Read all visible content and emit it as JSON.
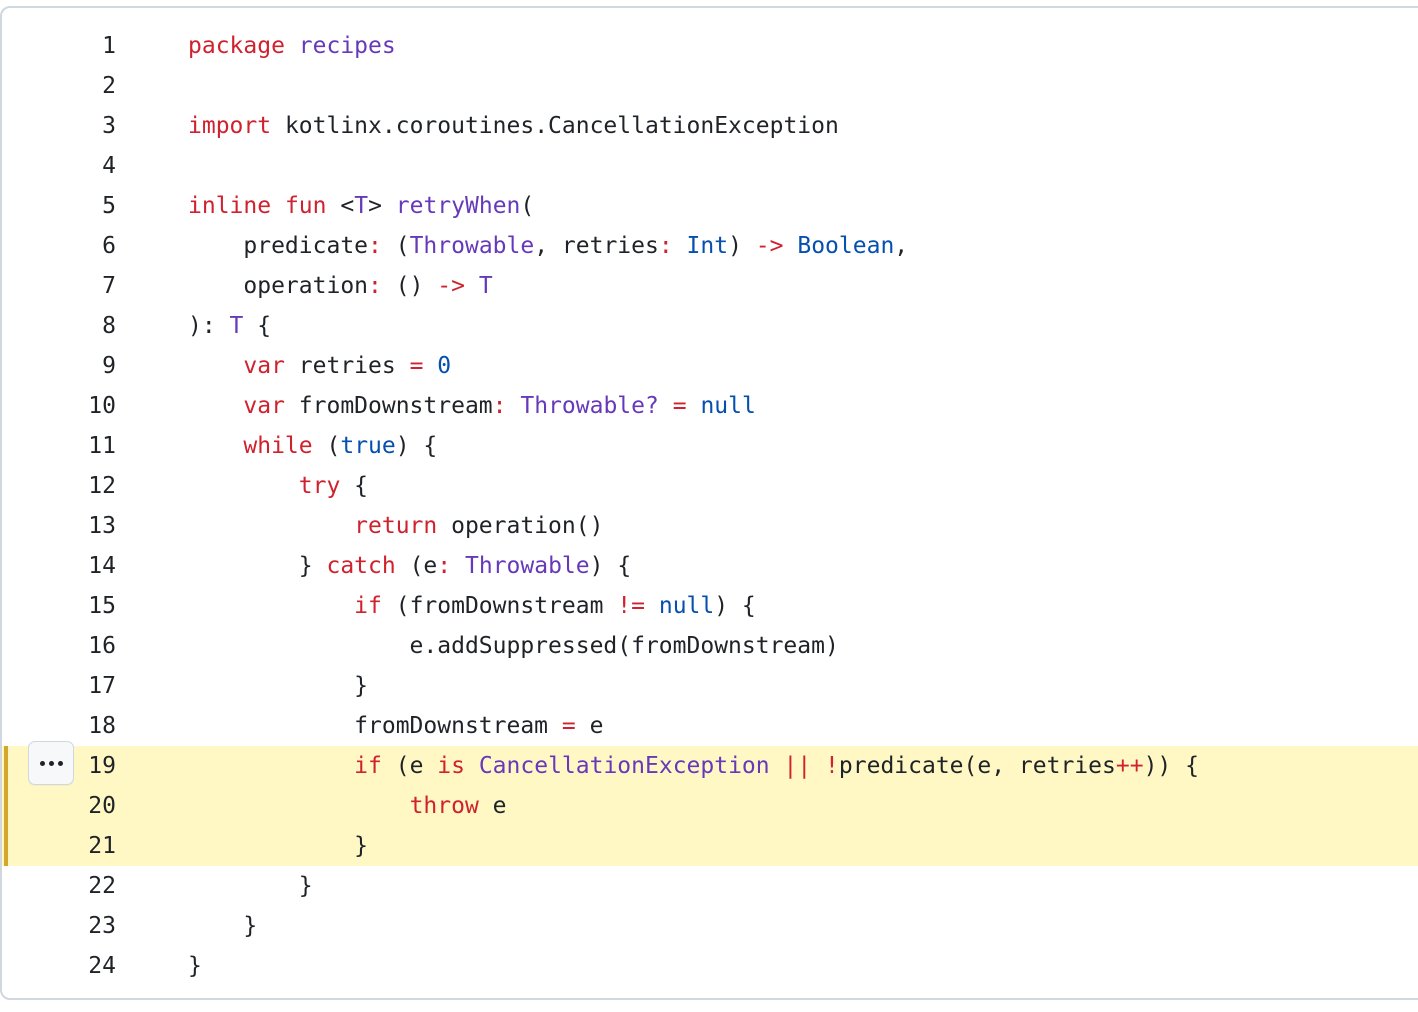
{
  "colors": {
    "keyword": "#cf222e",
    "entity": "#6639ba",
    "constant": "#0550ae",
    "plain": "#1f2328",
    "highlight_bg": "#fff8c5",
    "highlight_bar": "#d4a72c"
  },
  "more_button": {
    "icon": "kebab-horizontal-icon"
  },
  "highlighted_lines": [
    19,
    20,
    21
  ],
  "lines": [
    {
      "number": "1",
      "tokens": [
        {
          "t": "package",
          "c": "kw"
        },
        {
          "t": " ",
          "c": "pl"
        },
        {
          "t": "recipes",
          "c": "ent"
        }
      ]
    },
    {
      "number": "2",
      "tokens": []
    },
    {
      "number": "3",
      "tokens": [
        {
          "t": "import",
          "c": "kw"
        },
        {
          "t": " kotlinx.coroutines.CancellationException",
          "c": "pl"
        }
      ]
    },
    {
      "number": "4",
      "tokens": []
    },
    {
      "number": "5",
      "tokens": [
        {
          "t": "inline",
          "c": "kw"
        },
        {
          "t": " ",
          "c": "pl"
        },
        {
          "t": "fun",
          "c": "kw"
        },
        {
          "t": " <",
          "c": "pl"
        },
        {
          "t": "T",
          "c": "ent"
        },
        {
          "t": "> ",
          "c": "pl"
        },
        {
          "t": "retryWhen",
          "c": "ent"
        },
        {
          "t": "(",
          "c": "pl"
        }
      ]
    },
    {
      "number": "6",
      "tokens": [
        {
          "t": "    predicate",
          "c": "pl"
        },
        {
          "t": ":",
          "c": "kw"
        },
        {
          "t": " (",
          "c": "pl"
        },
        {
          "t": "Throwable",
          "c": "ent"
        },
        {
          "t": ", retries",
          "c": "pl"
        },
        {
          "t": ":",
          "c": "kw"
        },
        {
          "t": " ",
          "c": "pl"
        },
        {
          "t": "Int",
          "c": "cst"
        },
        {
          "t": ") ",
          "c": "pl"
        },
        {
          "t": "->",
          "c": "kw"
        },
        {
          "t": " ",
          "c": "pl"
        },
        {
          "t": "Boolean",
          "c": "cst"
        },
        {
          "t": ",",
          "c": "pl"
        }
      ]
    },
    {
      "number": "7",
      "tokens": [
        {
          "t": "    operation",
          "c": "pl"
        },
        {
          "t": ":",
          "c": "kw"
        },
        {
          "t": " () ",
          "c": "pl"
        },
        {
          "t": "->",
          "c": "kw"
        },
        {
          "t": " ",
          "c": "pl"
        },
        {
          "t": "T",
          "c": "ent"
        }
      ]
    },
    {
      "number": "8",
      "tokens": [
        {
          "t": "): ",
          "c": "pl"
        },
        {
          "t": "T",
          "c": "ent"
        },
        {
          "t": " {",
          "c": "pl"
        }
      ]
    },
    {
      "number": "9",
      "tokens": [
        {
          "t": "    ",
          "c": "pl"
        },
        {
          "t": "var",
          "c": "kw"
        },
        {
          "t": " retries ",
          "c": "pl"
        },
        {
          "t": "=",
          "c": "kw"
        },
        {
          "t": " ",
          "c": "pl"
        },
        {
          "t": "0",
          "c": "cst"
        }
      ]
    },
    {
      "number": "10",
      "tokens": [
        {
          "t": "    ",
          "c": "pl"
        },
        {
          "t": "var",
          "c": "kw"
        },
        {
          "t": " fromDownstream",
          "c": "pl"
        },
        {
          "t": ":",
          "c": "kw"
        },
        {
          "t": " ",
          "c": "pl"
        },
        {
          "t": "Throwable?",
          "c": "ent"
        },
        {
          "t": " ",
          "c": "pl"
        },
        {
          "t": "=",
          "c": "kw"
        },
        {
          "t": " ",
          "c": "pl"
        },
        {
          "t": "null",
          "c": "cst"
        }
      ]
    },
    {
      "number": "11",
      "tokens": [
        {
          "t": "    ",
          "c": "pl"
        },
        {
          "t": "while",
          "c": "kw"
        },
        {
          "t": " (",
          "c": "pl"
        },
        {
          "t": "true",
          "c": "cst"
        },
        {
          "t": ") {",
          "c": "pl"
        }
      ]
    },
    {
      "number": "12",
      "tokens": [
        {
          "t": "        ",
          "c": "pl"
        },
        {
          "t": "try",
          "c": "kw"
        },
        {
          "t": " {",
          "c": "pl"
        }
      ]
    },
    {
      "number": "13",
      "tokens": [
        {
          "t": "            ",
          "c": "pl"
        },
        {
          "t": "return",
          "c": "kw"
        },
        {
          "t": " operation()",
          "c": "pl"
        }
      ]
    },
    {
      "number": "14",
      "tokens": [
        {
          "t": "        } ",
          "c": "pl"
        },
        {
          "t": "catch",
          "c": "kw"
        },
        {
          "t": " (e",
          "c": "pl"
        },
        {
          "t": ":",
          "c": "kw"
        },
        {
          "t": " ",
          "c": "pl"
        },
        {
          "t": "Throwable",
          "c": "ent"
        },
        {
          "t": ") {",
          "c": "pl"
        }
      ]
    },
    {
      "number": "15",
      "tokens": [
        {
          "t": "            ",
          "c": "pl"
        },
        {
          "t": "if",
          "c": "kw"
        },
        {
          "t": " (fromDownstream ",
          "c": "pl"
        },
        {
          "t": "!=",
          "c": "kw"
        },
        {
          "t": " ",
          "c": "pl"
        },
        {
          "t": "null",
          "c": "cst"
        },
        {
          "t": ") {",
          "c": "pl"
        }
      ]
    },
    {
      "number": "16",
      "tokens": [
        {
          "t": "                e.addSuppressed(fromDownstream)",
          "c": "pl"
        }
      ]
    },
    {
      "number": "17",
      "tokens": [
        {
          "t": "            }",
          "c": "pl"
        }
      ]
    },
    {
      "number": "18",
      "tokens": [
        {
          "t": "            fromDownstream ",
          "c": "pl"
        },
        {
          "t": "=",
          "c": "kw"
        },
        {
          "t": " e",
          "c": "pl"
        }
      ]
    },
    {
      "number": "19",
      "tokens": [
        {
          "t": "            ",
          "c": "pl"
        },
        {
          "t": "if",
          "c": "kw"
        },
        {
          "t": " (e ",
          "c": "pl"
        },
        {
          "t": "is",
          "c": "kw"
        },
        {
          "t": " ",
          "c": "pl"
        },
        {
          "t": "CancellationException",
          "c": "ent"
        },
        {
          "t": " ",
          "c": "pl"
        },
        {
          "t": "||",
          "c": "kw"
        },
        {
          "t": " ",
          "c": "pl"
        },
        {
          "t": "!",
          "c": "kw"
        },
        {
          "t": "predicate(e, retries",
          "c": "pl"
        },
        {
          "t": "++",
          "c": "kw"
        },
        {
          "t": ")) {",
          "c": "pl"
        }
      ]
    },
    {
      "number": "20",
      "tokens": [
        {
          "t": "                ",
          "c": "pl"
        },
        {
          "t": "throw",
          "c": "kw"
        },
        {
          "t": " e",
          "c": "pl"
        }
      ]
    },
    {
      "number": "21",
      "tokens": [
        {
          "t": "            }",
          "c": "pl"
        }
      ]
    },
    {
      "number": "22",
      "tokens": [
        {
          "t": "        }",
          "c": "pl"
        }
      ]
    },
    {
      "number": "23",
      "tokens": [
        {
          "t": "    }",
          "c": "pl"
        }
      ]
    },
    {
      "number": "24",
      "tokens": [
        {
          "t": "}",
          "c": "pl"
        }
      ]
    }
  ]
}
